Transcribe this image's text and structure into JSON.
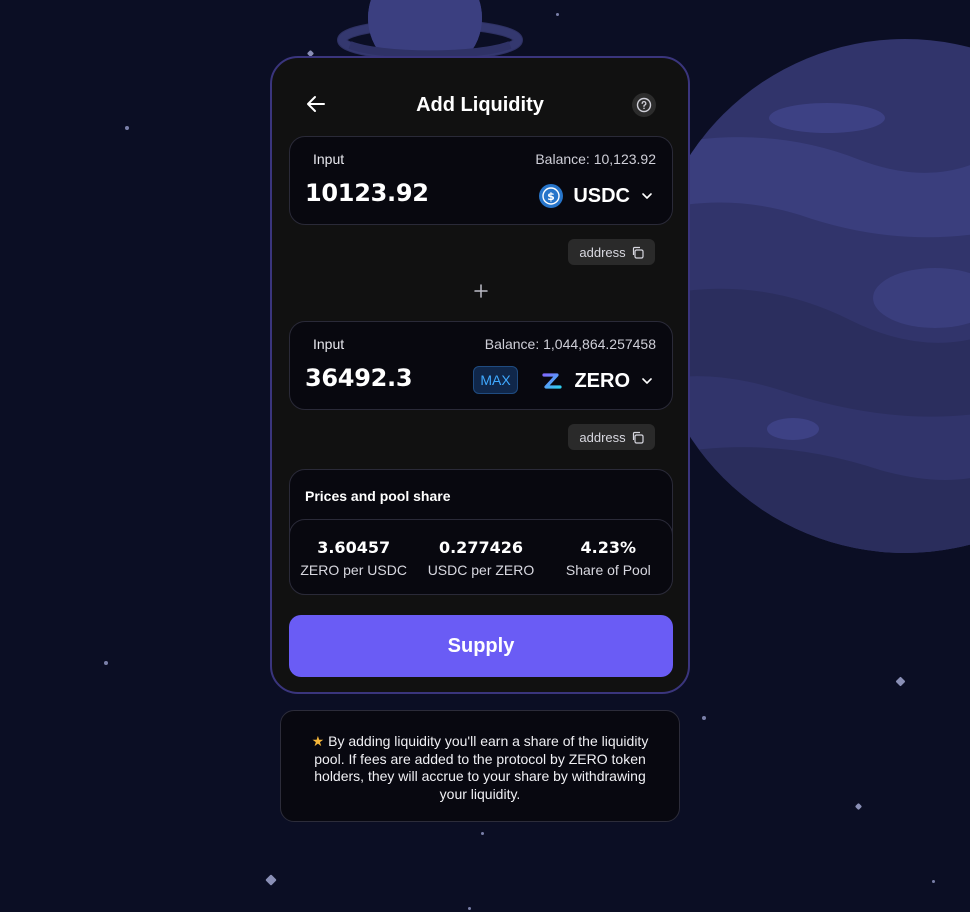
{
  "header": {
    "title": "Add Liquidity"
  },
  "input1": {
    "label": "Input",
    "balance": "Balance: 10,123.92",
    "amount": "10123.92",
    "token": "USDC",
    "token_icon": "usdc-icon",
    "address_label": "address"
  },
  "input2": {
    "label": "Input",
    "balance": "Balance: 1,044,864.257458",
    "amount": "36492.3",
    "max_label": "MAX",
    "token": "ZERO",
    "token_icon": "zero-icon",
    "address_label": "address"
  },
  "prices": {
    "title": "Prices and pool share",
    "items": [
      {
        "value": "3.60457",
        "label": "ZERO per USDC"
      },
      {
        "value": "0.277426",
        "label": "USDC per ZERO"
      },
      {
        "value": "4.23%",
        "label": "Share of Pool"
      }
    ]
  },
  "supply_label": "Supply",
  "info": {
    "star": "★",
    "text": "By adding liquidity you'll earn a share of the liquidity pool. If fees are added to the protocol by ZERO token holders, they will accrue to your share by withdrawing your liquidity."
  },
  "colors": {
    "background": "#0b0e24",
    "card": "#111111",
    "card_border": "#3a357d",
    "accent": "#6a5cf5",
    "max": "#3fa9ff",
    "usdc": "#2775ca",
    "star": "#f5b63a"
  }
}
